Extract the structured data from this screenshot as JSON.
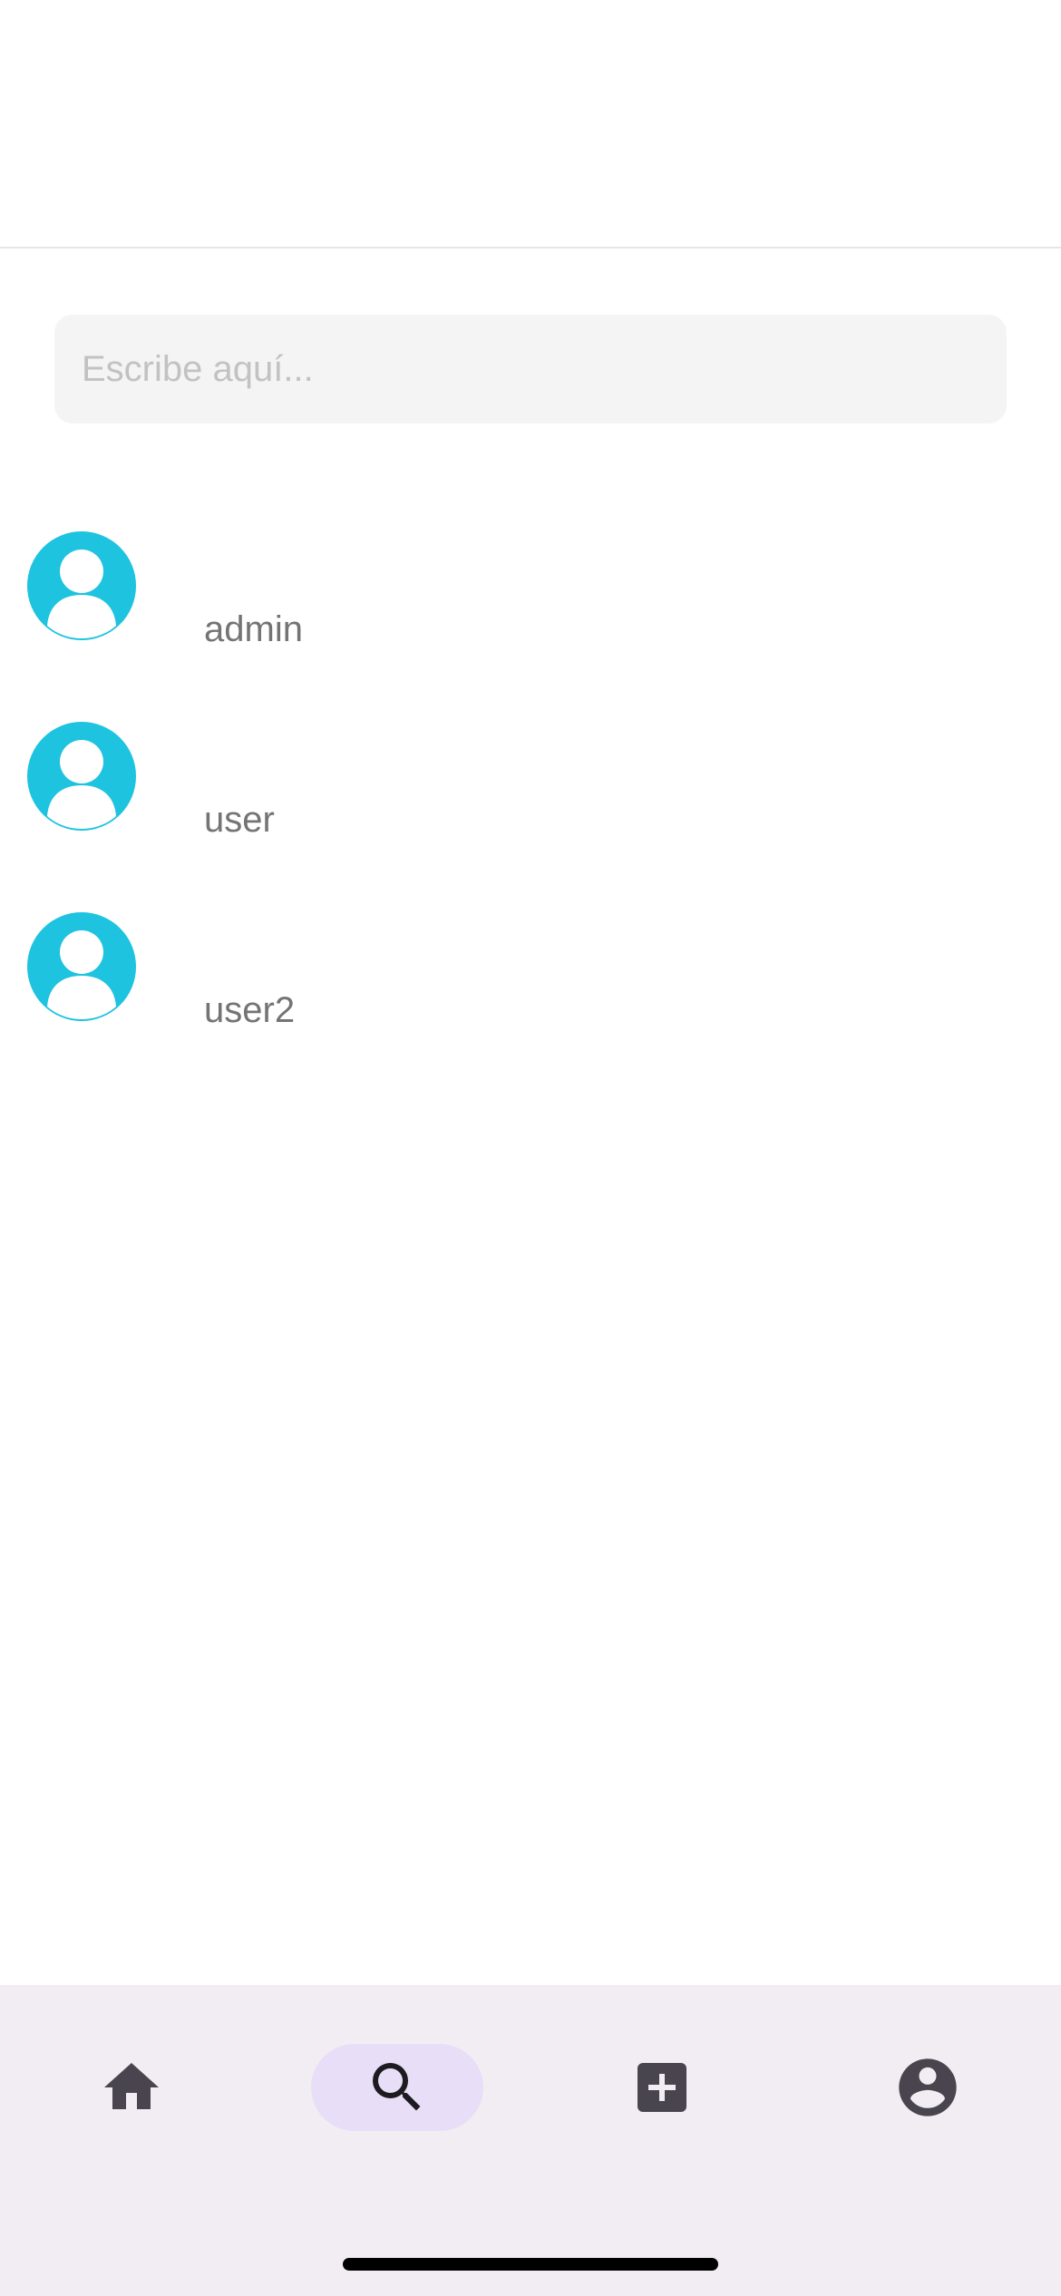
{
  "search": {
    "placeholder": "Escribe aquí...",
    "value": ""
  },
  "users": [
    {
      "name": "admin",
      "avatar_icon": "person-avatar-icon"
    },
    {
      "name": "user",
      "avatar_icon": "person-avatar-icon"
    },
    {
      "name": "user2",
      "avatar_icon": "person-avatar-icon"
    }
  ],
  "bottom_nav": {
    "items": [
      {
        "name": "home",
        "icon": "home-icon",
        "active": false
      },
      {
        "name": "search",
        "icon": "search-icon",
        "active": true
      },
      {
        "name": "add",
        "icon": "add-box-icon",
        "active": false
      },
      {
        "name": "profile",
        "icon": "account-circle-icon",
        "active": false
      }
    ]
  },
  "colors": {
    "avatar": "#1ec3e0",
    "nav_background": "#f2edf3",
    "nav_active_pill": "#e8def7",
    "nav_icon": "#49454f",
    "username_text": "#747474",
    "search_background": "#f4f4f4"
  }
}
